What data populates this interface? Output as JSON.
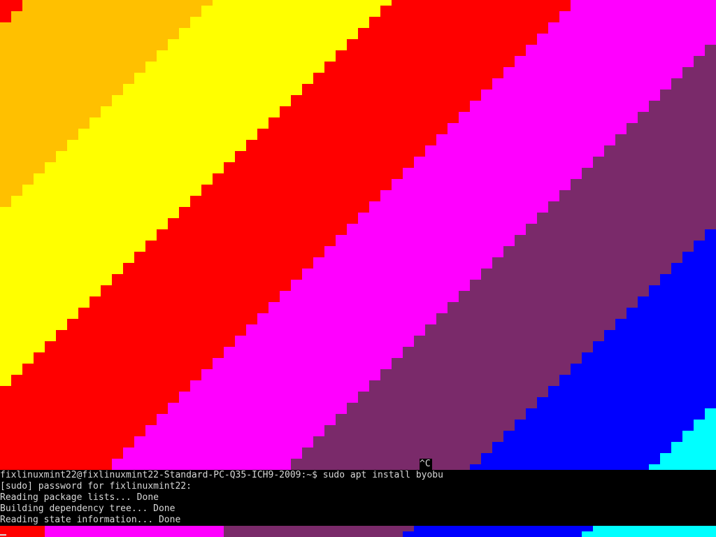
{
  "screen": {
    "background": "#000000",
    "text_color": "#d8d8d8"
  },
  "rainbow": {
    "description_colors": [
      "#ffc000",
      "#ffff00",
      "#ff0000",
      "#ff00ff",
      "#7a2a6a",
      "#0000ff",
      "#00ffff",
      "#2ab0e8",
      "#00ff00",
      "#ffff00",
      "#ffc000",
      "#ff0000"
    ]
  },
  "terminal": {
    "ctrl_c": "^C",
    "prompt_line": "fixlinuxmint22@fixlinuxmint22-Standard-PC-Q35-ICH9-2009:~$ sudo apt install byobu",
    "sudo_line": "[sudo] password for fixlinuxmint22:",
    "reading_lists": "Reading package lists... Done",
    "dependency_tree": "Building dependency tree... Done",
    "state_info": "Reading state information... Done"
  }
}
